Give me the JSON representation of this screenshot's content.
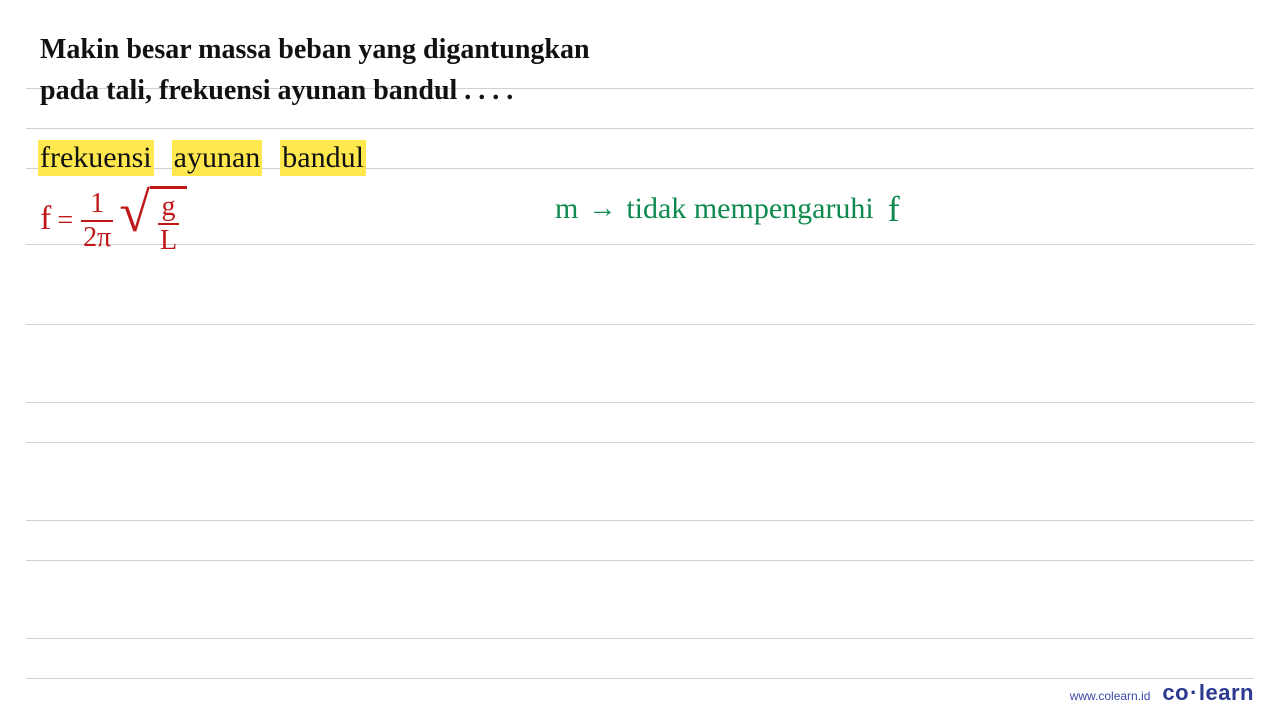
{
  "question": {
    "line1": "Makin besar massa beban yang digantungkan",
    "line2": "pada tali, frekuensi ayunan bandul . . . ."
  },
  "highlight": {
    "w1": "frekuensi",
    "w2": "ayunan",
    "w3": "bandul"
  },
  "formula": {
    "lhs": "f",
    "eq": "=",
    "frac1_num": "1",
    "frac1_den": "2π",
    "rad_num": "g",
    "rad_den": "L"
  },
  "note": {
    "m": "m",
    "arrow": "→",
    "text": "tidak mempengaruhi",
    "f": "f"
  },
  "footer": {
    "url": "www.colearn.id",
    "brand_pre": "co",
    "brand_dot": "·",
    "brand_post": "learn"
  },
  "ruled_line_tops": [
    88,
    128,
    168,
    244,
    324,
    402,
    442,
    520,
    560,
    638,
    678
  ]
}
